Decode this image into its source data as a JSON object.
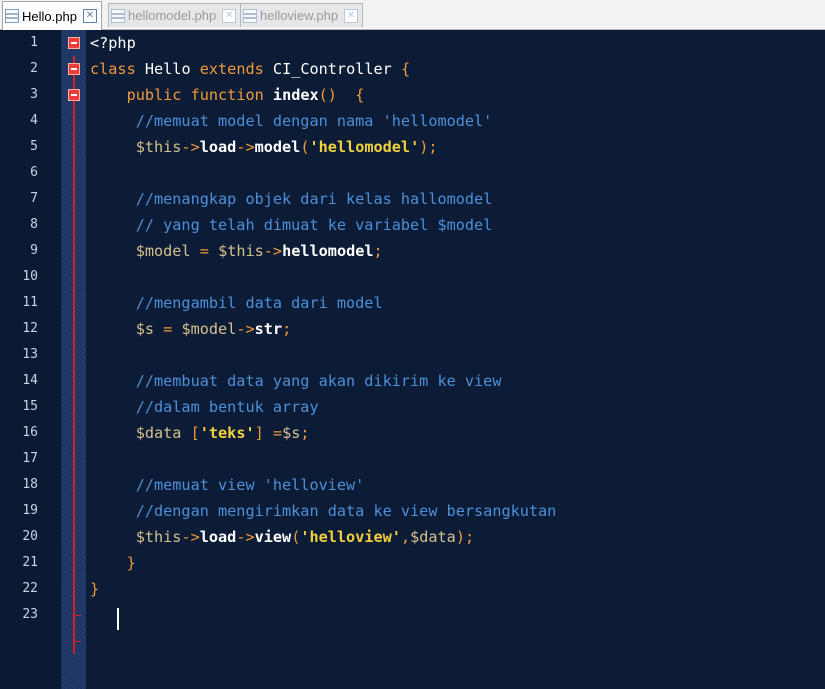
{
  "tabs": [
    {
      "label": "Hello.php",
      "active": true
    },
    {
      "label": "hellomodel.php",
      "active": false
    },
    {
      "label": "helloview.php",
      "active": false
    }
  ],
  "close_glyph": "✕",
  "editor": {
    "line_numbers": [
      "1",
      "2",
      "3",
      "4",
      "5",
      "6",
      "7",
      "8",
      "9",
      "10",
      "11",
      "12",
      "13",
      "14",
      "15",
      "16",
      "17",
      "18",
      "19",
      "20",
      "21",
      "22",
      "23"
    ],
    "tokens": {
      "l1_a": "<?php",
      "l2_a": "class",
      "l2_b": "Hello",
      "l2_c": "extends",
      "l2_d": "CI_Controller",
      "l2_e": "{",
      "l3_a": "public",
      "l3_b": "function",
      "l3_c": "index",
      "l3_d": "()",
      "l3_e": "{",
      "l4_a": "//memuat model dengan nama 'hellomodel'",
      "l5_a": "$this",
      "l5_b": "->",
      "l5_c": "load",
      "l5_d": "->",
      "l5_e": "model",
      "l5_f": "(",
      "l5_g": "'hellomodel'",
      "l5_h": ");",
      "l7_a": "//menangkap objek dari kelas hallomodel",
      "l8_a": "// yang telah dimuat ke variabel $model",
      "l9_a": "$model",
      "l9_b": "=",
      "l9_c": "$this",
      "l9_d": "->",
      "l9_e": "hellomodel",
      "l9_f": ";",
      "l11_a": "//mengambil data dari model",
      "l12_a": "$s",
      "l12_b": "=",
      "l12_c": "$model",
      "l12_d": "->",
      "l12_e": "str",
      "l12_f": ";",
      "l14_a": "//membuat data yang akan dikirim ke view",
      "l15_a": "//dalam bentuk array",
      "l16_a": "$data",
      "l16_b": "[",
      "l16_c": "'teks'",
      "l16_d": "]",
      "l16_e": "=",
      "l16_f": "$s",
      "l16_g": ";",
      "l18_a": "//memuat view 'helloview'",
      "l19_a": "//dengan mengirimkan data ke view bersangkutan",
      "l20_a": "$this",
      "l20_b": "->",
      "l20_c": "load",
      "l20_d": "->",
      "l20_e": "view",
      "l20_f": "(",
      "l20_g": "'helloview'",
      "l20_h": ",",
      "l20_i": "$data",
      "l20_j": ");",
      "l21_a": "}",
      "l22_a": "}"
    }
  },
  "colors": {
    "editor_background": "#0c1c37",
    "comment": "#4d8fd9",
    "keyword": "#f19a3a",
    "string": "#f2d13c",
    "variable": "#d5c08d",
    "fold_marker": "#ee3b3b"
  },
  "icons": {
    "tab_file": "file-icon",
    "tab_close": "close-icon",
    "fold": "fold-minus-icon"
  }
}
